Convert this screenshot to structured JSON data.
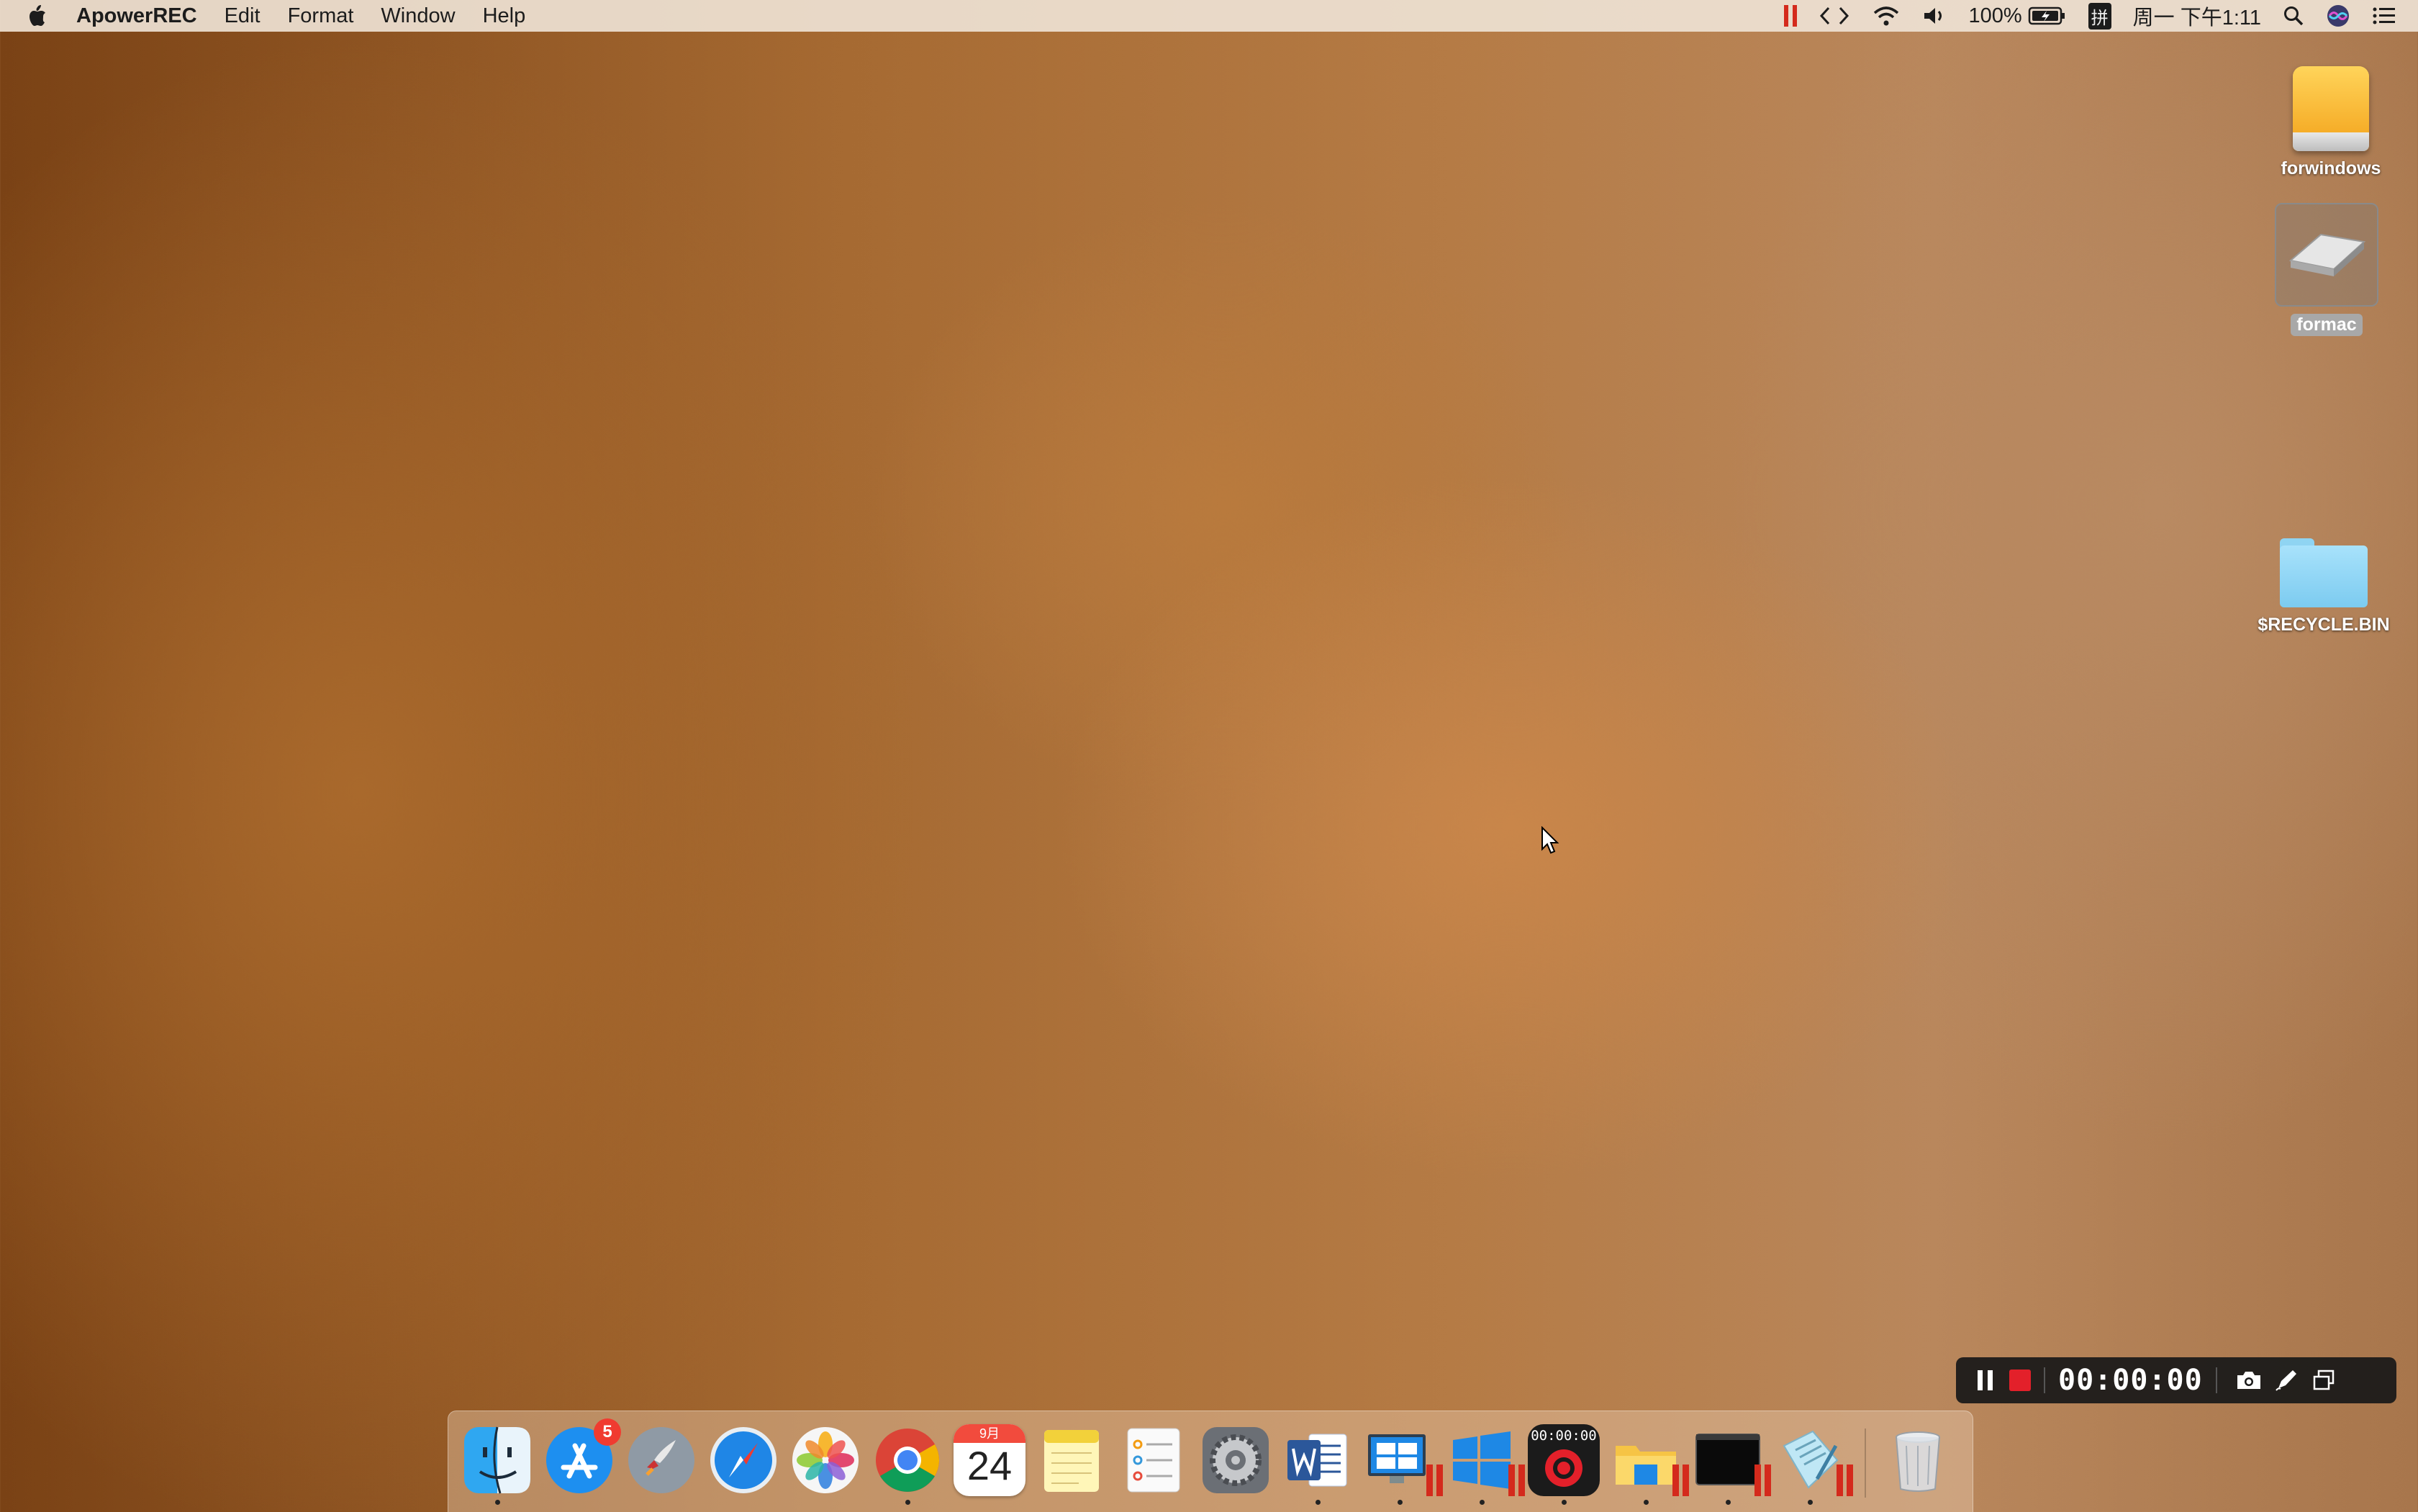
{
  "menubar": {
    "app_name": "ApowerREC",
    "menus": [
      "Edit",
      "Format",
      "Window",
      "Help"
    ],
    "battery": "100%",
    "input_method": "拼",
    "clock": "周一 下午1:11"
  },
  "desktop": {
    "icons": [
      {
        "label": "forwindows",
        "icon": "external-drive-icon"
      },
      {
        "label": "formac",
        "icon": "internal-drive-icon",
        "selected": true
      },
      {
        "label": "$RECYCLE.BIN",
        "icon": "folder-icon"
      }
    ]
  },
  "recorder": {
    "time": "00:00:00",
    "colors": {
      "stop": "#e3202a",
      "bar": "#191919"
    }
  },
  "dock": {
    "items": [
      {
        "name": "Finder",
        "icon": "finder-icon"
      },
      {
        "name": "App Store",
        "icon": "app-store-icon",
        "badge": "5"
      },
      {
        "name": "Launchpad",
        "icon": "launchpad-icon"
      },
      {
        "name": "Safari",
        "icon": "safari-icon"
      },
      {
        "name": "Photos",
        "icon": "photos-icon"
      },
      {
        "name": "Chrome",
        "icon": "chrome-icon"
      },
      {
        "name": "Calendar",
        "icon": "calendar-icon",
        "month": "9月",
        "day": "24"
      },
      {
        "name": "Notes",
        "icon": "notes-icon"
      },
      {
        "name": "Reminders",
        "icon": "reminders-icon"
      },
      {
        "name": "System Preferences",
        "icon": "system-preferences-icon"
      },
      {
        "name": "Word",
        "icon": "word-icon"
      },
      {
        "name": "Windows Desktop",
        "icon": "windows-desktop-icon"
      },
      {
        "name": "Windows",
        "icon": "windows-icon"
      },
      {
        "name": "ApowerREC",
        "icon": "apowerrec-icon",
        "time": "00:00:00"
      },
      {
        "name": "File Explorer",
        "icon": "file-explorer-icon"
      },
      {
        "name": "Terminal",
        "icon": "terminal-icon"
      },
      {
        "name": "Notepad",
        "icon": "notepad-icon"
      },
      {
        "name": "Trash",
        "icon": "trash-icon"
      }
    ]
  }
}
